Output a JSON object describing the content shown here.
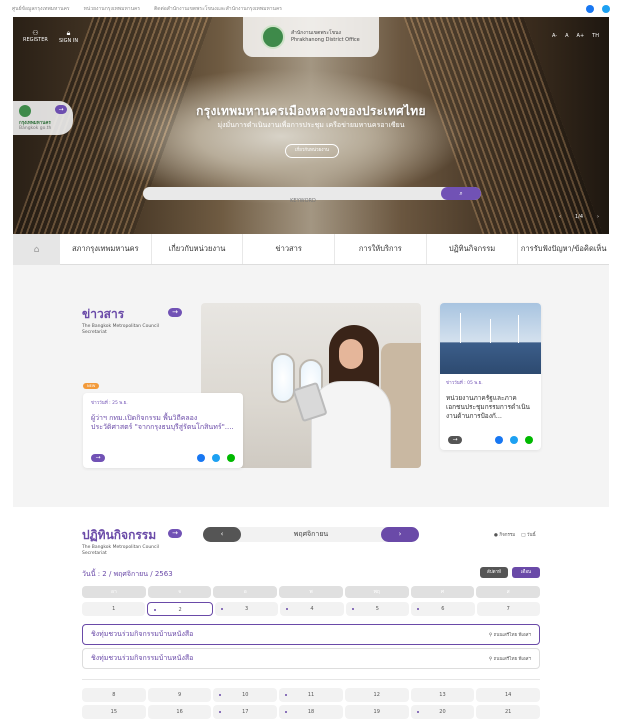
{
  "topbar": {
    "links": [
      "ศูนย์ข้อมูลกรุงเทพมหานคร",
      "หน่วยงานกรุงเทพมหานคร",
      "ติดต่อสำนักงานเขตพระโขนงและสำนักงานกรุงเทพมหานคร"
    ],
    "social": [
      {
        "icon": "facebook-icon",
        "color": "#1877f2"
      },
      {
        "icon": "twitter-icon",
        "color": "#1da1f2"
      }
    ]
  },
  "hero": {
    "register": "REGISTER",
    "signin": "SIGN IN",
    "office_name_th": "สำนักงานเขตพระโขนง",
    "office_name_en": "Phrakhanong District Office",
    "font_controls": [
      "A-",
      "A",
      "A+",
      "TH"
    ],
    "bkk_title": "กรุงเทพมหานคร",
    "bkk_sub": "Bangkok go.th",
    "headline": "กรุงเทพมหานครเมืองหลวงของประเทศไทย",
    "subline": "มุ่งมั่นการดำเนินงานเพื่อการประชุม เครือข่ายมหานครอาเซียน",
    "about_button": "เกี่ยวกับหน่วยงาน",
    "search_placeholder": "KEYWORD",
    "pager": "1/4",
    "prev": "‹",
    "next": "›"
  },
  "nav": {
    "home_icon": "home-icon",
    "items": [
      "สภากรุงเทพมหานคร",
      "เกี่ยวกับหน่วยงาน",
      "ข่าวสาร",
      "การให้บริการ",
      "ปฏิทินกิจกรรม",
      "การรับฟังปัญหา/ข้อคิดเห็น"
    ]
  },
  "news": {
    "title": "ข่าวสาร",
    "subtitle": "The Bangkok Metropolitan Council Secretariat",
    "badge": "NEW",
    "main": {
      "date": "ข่าววันที่ : 25 พ.ย.",
      "title": "ผู้ว่าฯ กทม.เปิดกิจกรรม พื้นวิถีคลอง ประวัติศาสตร์ \"จากกรุงธนบุรีสู่รัตนโกสินทร์\"...."
    },
    "side": {
      "date": "ข่าววันที่ : 05 พ.ย.",
      "title": "หน่วยงานภาครัฐและภาคเอกชนประชุมกรรมการดำเนินงานด้านการป้องกั..."
    }
  },
  "activities": {
    "title": "ปฏิทินกิจกรรม",
    "subtitle": "The Bangkok Metropolitan Council Secretariat",
    "month": "พฤศจิกายน",
    "view_options": [
      "● กิจกรรม",
      "□ วันนี้"
    ],
    "date_line": "วันนี้ : 2 / พฤศจิกายน / 2563",
    "week_btn": "สัปดาห์",
    "month_btn": "เดือน",
    "weekdays": [
      "อา",
      "จ",
      "อ",
      "พ",
      "พฤ",
      "ศ",
      "ส"
    ],
    "week1": [
      "1",
      "2",
      "3",
      "4",
      "5",
      "6",
      "7"
    ],
    "week2": [
      "8",
      "9",
      "10",
      "11",
      "12",
      "13",
      "14"
    ],
    "week3": [
      "15",
      "16",
      "17",
      "18",
      "19",
      "20",
      "21"
    ],
    "events": [
      {
        "name": "ชิงทุ่มชวนร่วมกิจกรรมบ้านหนังสือ",
        "location": "ถนนเสรีไทย พีเอสฯ"
      },
      {
        "name": "ชิงทุ่มชวนร่วมกิจกรรมบ้านหนังสือ",
        "location": "ถนนเสรีไทย พีเอสฯ"
      }
    ]
  },
  "colors": {
    "accent": "#6a4aa8",
    "button": "#7152b5",
    "badge": "#f29a3a"
  }
}
